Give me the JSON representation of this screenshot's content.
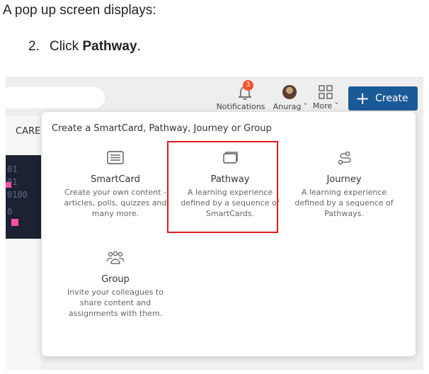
{
  "doc": {
    "intro": "A pop up screen displays:",
    "step_number": "2.",
    "step_prefix": "Click ",
    "step_bold": "Pathway",
    "step_suffix": "."
  },
  "header": {
    "notifications_label": "Notifications",
    "notifications_count": "3",
    "user_label": "Anurag ˅",
    "more_label": "More ˅",
    "create_label": "Create",
    "brand_color": "#1a5a96",
    "badge_color": "#f2542d"
  },
  "background": {
    "tab_partial": "CARE",
    "thumb_text": [
      "01",
      " 01",
      "0100",
      " 0"
    ]
  },
  "popup": {
    "title": "Create a SmartCard, Pathway, Journey or Group",
    "options": [
      {
        "icon": "smartcard-icon",
        "title": "SmartCard",
        "desc": [
          "Create your own content -",
          "articles, polls, quizzes and",
          "many more."
        ]
      },
      {
        "icon": "pathway-icon",
        "title": "Pathway",
        "desc": [
          "A learning experience",
          "defined by a sequence of",
          "SmartCards."
        ]
      },
      {
        "icon": "journey-icon",
        "title": "Journey",
        "desc": [
          "A learning experience",
          "defined by a sequence of",
          "Pathways."
        ]
      },
      {
        "icon": "group-icon",
        "title": "Group",
        "desc": [
          "Invite your colleagues to",
          "share content and",
          "assignments with them."
        ]
      }
    ],
    "highlight_color": "#e01b1b"
  }
}
